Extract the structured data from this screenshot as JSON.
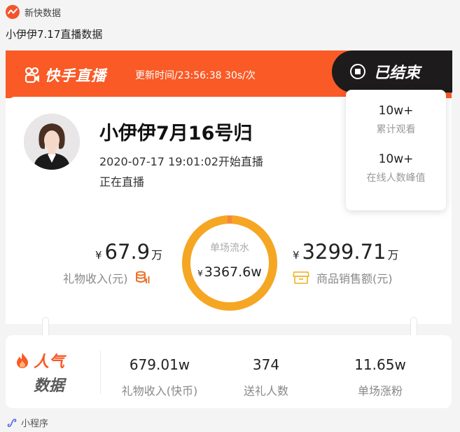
{
  "header": {
    "app_name": "新快数据",
    "post_title": "小伊伊7.17直播数据"
  },
  "banner": {
    "brand": "快手直播",
    "update_time": "更新时间/23:56:38  30s/次",
    "status_label": "已结束"
  },
  "streamer": {
    "name": "小伊伊7月16号归",
    "start_time": "2020-07-17 19:01:02开始直播",
    "status": "正在直播"
  },
  "popup": {
    "total_views_value": "10w+",
    "total_views_label": "累计观看",
    "peak_online_value": "10w+",
    "peak_online_label": "在线人数峰值"
  },
  "revenue": {
    "currency": "¥",
    "gift_value": "67.9",
    "gift_unit": "万",
    "gift_label": "礼物收入(元)",
    "session_label": "单场流水",
    "session_value": "3367.6w",
    "goods_value": "3299.71",
    "goods_unit": "万",
    "goods_label": "商品销售额(元)"
  },
  "popularity": {
    "title_line1": "人气",
    "title_line2": "数据",
    "stats": [
      {
        "value": "679.01w",
        "label": "礼物收入(快币)"
      },
      {
        "value": "374",
        "label": "送礼人数"
      },
      {
        "value": "11.65w",
        "label": "单场涨粉"
      }
    ]
  },
  "footer": {
    "label": "小程序"
  },
  "colors": {
    "accent": "#f95a26",
    "gauge": "#f5a623",
    "dark": "#1d1b1b"
  }
}
